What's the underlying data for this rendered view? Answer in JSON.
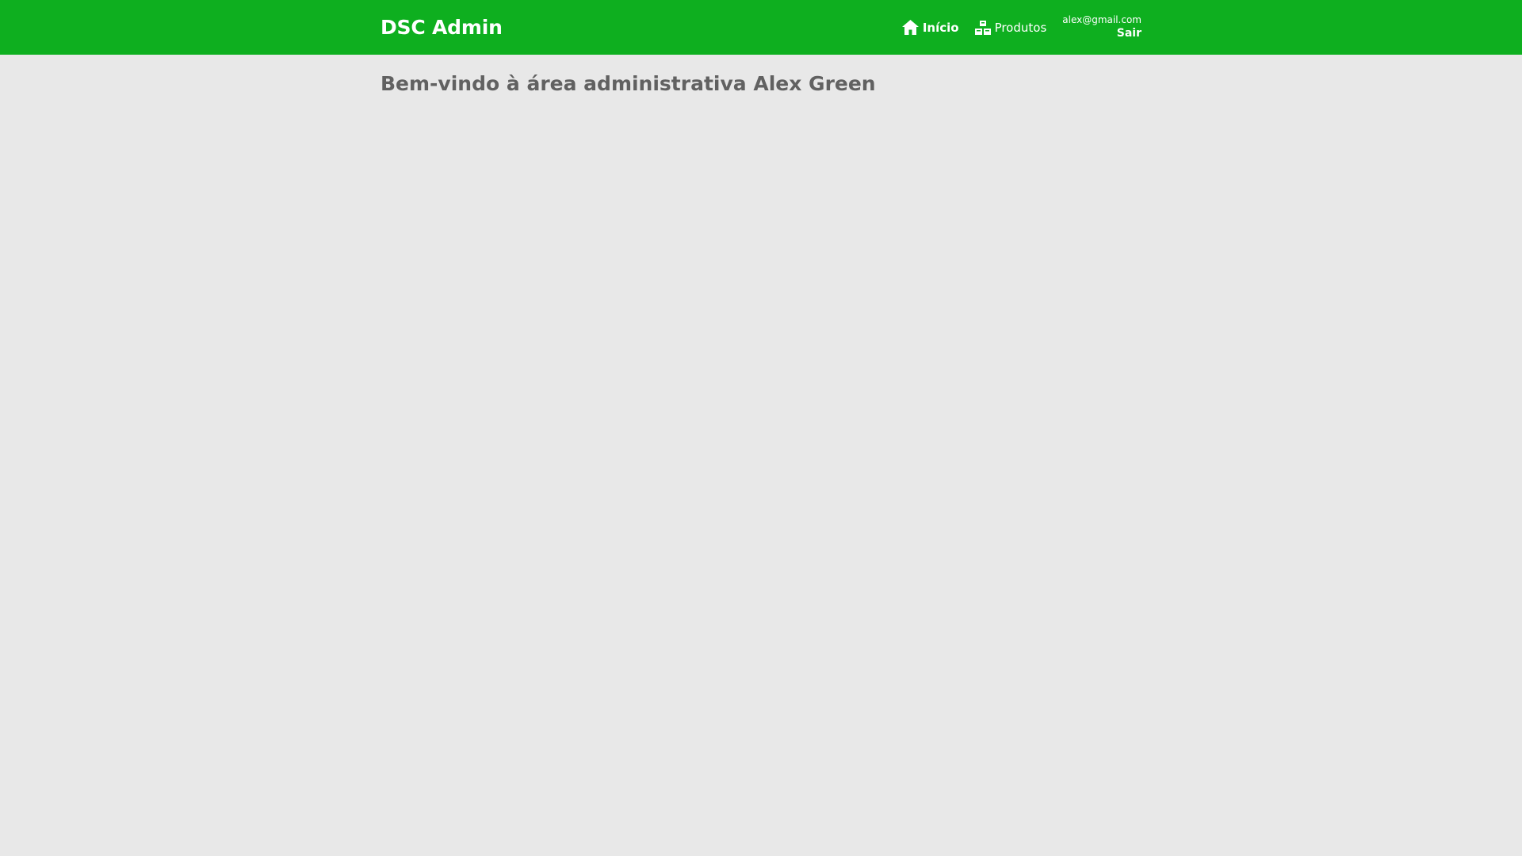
{
  "header": {
    "brand": "DSC Admin",
    "nav": [
      {
        "label": "Início",
        "icon": "home-icon",
        "active": true
      },
      {
        "label": "Produtos",
        "icon": "products-icon",
        "active": false
      }
    ],
    "user_email": "alex@gmail.com",
    "logout_label": "Sair"
  },
  "main": {
    "welcome_text": "Bem-vindo à área administrativa Alex Green"
  },
  "colors": {
    "navbar_bg": "#0eaf1f",
    "page_bg": "#e8e8e8",
    "heading_text": "#616161",
    "nav_text": "#ffffff"
  }
}
